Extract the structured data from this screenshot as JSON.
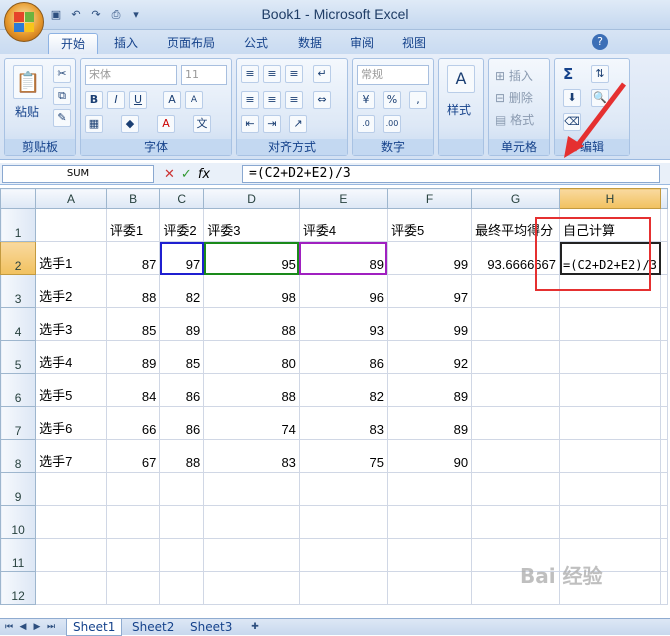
{
  "window": {
    "title": "Book1 - Microsoft Excel"
  },
  "tabs": [
    "开始",
    "插入",
    "页面布局",
    "公式",
    "数据",
    "审阅",
    "视图"
  ],
  "ribbon": {
    "clipboard": {
      "label": "剪贴板",
      "paste": "粘贴"
    },
    "font": {
      "label": "字体",
      "font_name": "宋体",
      "font_size": "11",
      "bold": "B",
      "italic": "I",
      "underline": "U"
    },
    "alignment": {
      "label": "对齐方式"
    },
    "number": {
      "label": "数字",
      "format": "常规",
      "percent": "%",
      "comma": ","
    },
    "styles": {
      "label": "样式",
      "button": "样式"
    },
    "cells": {
      "label": "单元格",
      "insert": "插入",
      "delete": "删除",
      "format": "格式"
    },
    "editing": {
      "label": "编辑",
      "sigma": "Σ"
    }
  },
  "formula_bar": {
    "name_box": "SUM",
    "fx": "fx",
    "formula": "=(C2+D2+E2)/3"
  },
  "columns": [
    "A",
    "B",
    "C",
    "D",
    "E",
    "F",
    "G",
    "H"
  ],
  "rows": [
    [
      "",
      "评委1",
      "评委2",
      "评委3",
      "评委4",
      "评委5",
      "最终平均得分",
      "自己计算"
    ],
    [
      "选手1",
      "87",
      "97",
      "95",
      "89",
      "99",
      "93.6666667",
      "=(C2+D2+E2)/3"
    ],
    [
      "选手2",
      "88",
      "82",
      "98",
      "96",
      "97",
      "",
      ""
    ],
    [
      "选手3",
      "85",
      "89",
      "88",
      "93",
      "99",
      "",
      ""
    ],
    [
      "选手4",
      "89",
      "85",
      "80",
      "86",
      "92",
      "",
      ""
    ],
    [
      "选手5",
      "84",
      "86",
      "88",
      "82",
      "89",
      "",
      ""
    ],
    [
      "选手6",
      "66",
      "86",
      "74",
      "83",
      "89",
      "",
      ""
    ],
    [
      "选手7",
      "67",
      "88",
      "83",
      "75",
      "90",
      "",
      ""
    ],
    [
      "",
      "",
      "",
      "",
      "",
      "",
      "",
      ""
    ],
    [
      "",
      "",
      "",
      "",
      "",
      "",
      "",
      ""
    ],
    [
      "",
      "",
      "",
      "",
      "",
      "",
      "",
      ""
    ],
    [
      "",
      "",
      "",
      "",
      "",
      "",
      "",
      ""
    ]
  ],
  "row_numbers": [
    "1",
    "2",
    "3",
    "4",
    "5",
    "6",
    "7",
    "8",
    "9",
    "10",
    "11",
    "12"
  ],
  "sheets": [
    "Sheet1",
    "Sheet2",
    "Sheet3"
  ],
  "watermark": "Bai 经验",
  "colors": {
    "accent": "#15428b",
    "red_annotation": "#e53030",
    "ref_blue": "#1f1fd0",
    "ref_green": "#1a8a1a",
    "ref_purple": "#a020c0"
  }
}
